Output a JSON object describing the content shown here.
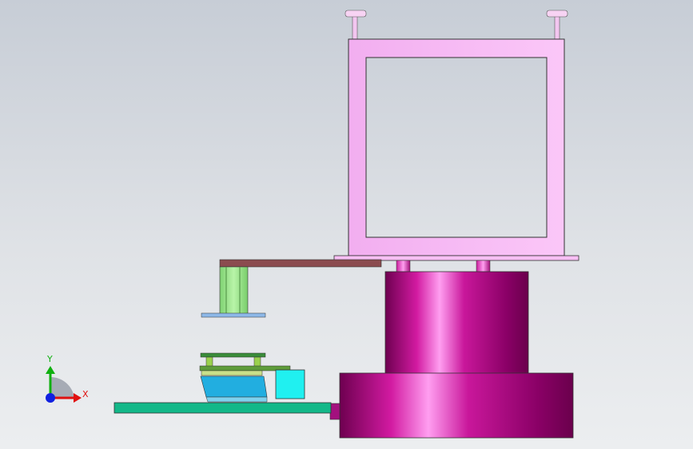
{
  "viewport": {
    "background_top": "#c7cdd6",
    "background_bottom": "#eceef0"
  },
  "triad": {
    "x_label": "X",
    "y_label": "Y",
    "x_color": "#e01010",
    "y_color": "#10b010",
    "z_color": "#1020e0"
  },
  "parts": {
    "frame_color": "#f7b6f5",
    "pedestal_color": "#c0178f",
    "bracket_color": "#8b4b4f",
    "column_color": "#9ae38a",
    "base_color": "#13b889",
    "cube_color": "#20f0f0",
    "fixture_color": "#22aee0"
  }
}
